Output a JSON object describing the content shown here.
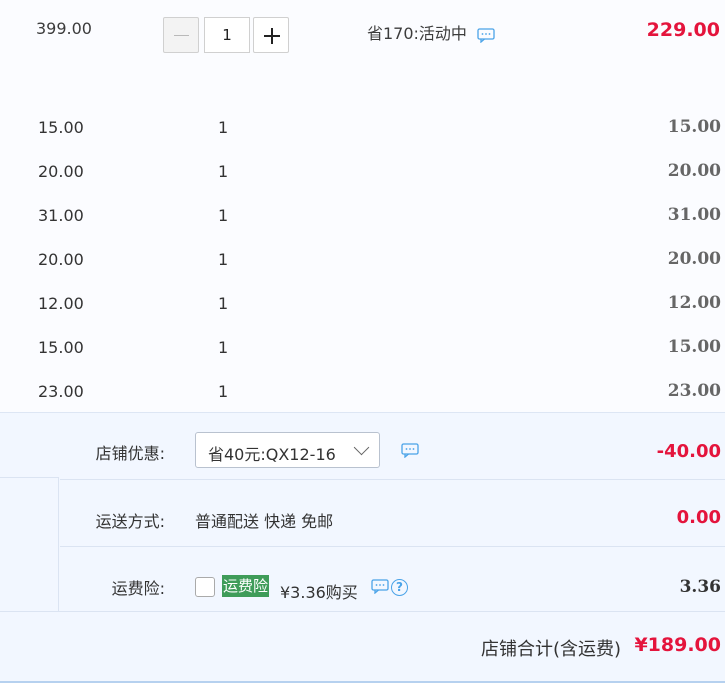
{
  "main_item": {
    "unit_price": "399.00",
    "quantity": "1",
    "promo": "省170:活动中",
    "subtotal": "229.00"
  },
  "items": [
    {
      "price": "15.00",
      "qty": "1",
      "subtotal": "15.00"
    },
    {
      "price": "20.00",
      "qty": "1",
      "subtotal": "20.00"
    },
    {
      "price": "31.00",
      "qty": "1",
      "subtotal": "31.00"
    },
    {
      "price": "20.00",
      "qty": "1",
      "subtotal": "20.00"
    },
    {
      "price": "12.00",
      "qty": "1",
      "subtotal": "12.00"
    },
    {
      "price": "15.00",
      "qty": "1",
      "subtotal": "15.00"
    },
    {
      "price": "23.00",
      "qty": "1",
      "subtotal": "23.00"
    }
  ],
  "store_discount": {
    "label": "店铺优惠:",
    "selected": "省40元:QX12-16",
    "amount": "-40.00"
  },
  "shipping": {
    "label": "运送方式:",
    "method": "普通配送 快递 免邮",
    "amount": "0.00"
  },
  "insurance": {
    "label": "运费险:",
    "badge": "运费险",
    "price": "¥3.36购买",
    "amount": "3.36"
  },
  "total": {
    "label": "店铺合计(含运费)",
    "amount": "¥189.00"
  },
  "colors": {
    "accent_red": "#e4143c",
    "bottom_bg": "#f2f7ff",
    "badge_green": "#3f9c59",
    "icon_blue": "#4aa3e8"
  },
  "icons": {
    "chat": "chat-bubble-icon",
    "help": "question-circle-icon",
    "minus": "minus-icon",
    "plus": "plus-icon",
    "dropdown": "chevron-down-icon"
  }
}
